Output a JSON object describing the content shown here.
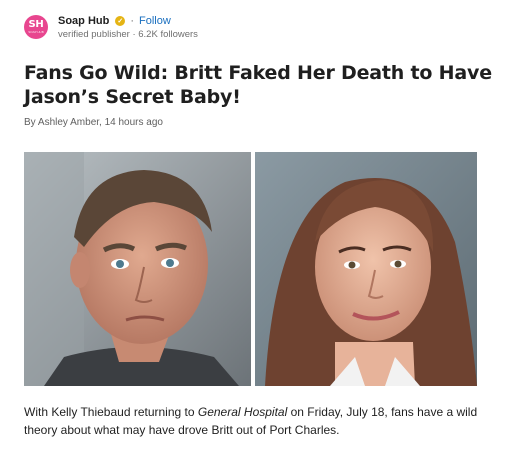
{
  "publisher": {
    "logo_text": "SH",
    "logo_subtext": "SOAP HUB",
    "name": "Soap Hub",
    "verified_icon": "check-badge-icon",
    "separator": "·",
    "follow_label": "Follow",
    "subtitle": "verified publisher · 6.2K followers"
  },
  "article": {
    "headline": "Fans Go Wild: Britt Faked Her Death to Have Jason’s Secret Baby!",
    "byline": "By Ashley Amber, 14 hours ago",
    "summary": {
      "part1": "With Kelly Thiebaud returning to ",
      "show": "General Hospital",
      "part2": " on Friday, July 18, fans have a wild theory about what may have drove Britt out of Port Charles."
    }
  },
  "colors": {
    "logo_bg": "#e8468f",
    "verified_badge": "#e5b414",
    "follow_link": "#1a6fbf"
  }
}
